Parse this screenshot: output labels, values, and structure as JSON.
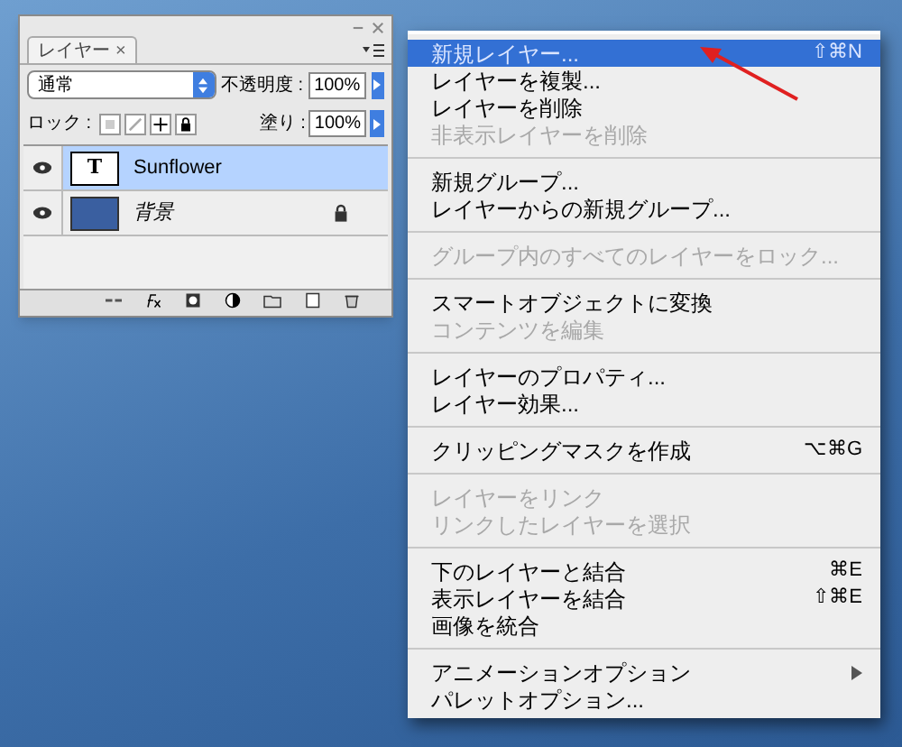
{
  "panel": {
    "tab": {
      "label": "レイヤー",
      "close": "×",
      "selected": true
    },
    "blend_mode": "通常",
    "opacity": {
      "label": "不透明度 :",
      "value": "100%"
    },
    "lock": {
      "label": "ロック :"
    },
    "fill": {
      "label": "塗り :",
      "value": "100%"
    },
    "layers": [
      {
        "name": "Sunflower",
        "kind": "text",
        "thumb_text": "T",
        "visible": true,
        "selected": true,
        "locked": false
      },
      {
        "name": "背景",
        "kind": "background",
        "visible": true,
        "selected": false,
        "locked": true
      }
    ]
  },
  "menu": {
    "groups": [
      [
        {
          "label": "新規レイヤー...",
          "shortcut": "⇧⌘N",
          "disabled": false,
          "selected": true
        },
        {
          "label": "レイヤーを複製...",
          "disabled": false,
          "selected": false
        },
        {
          "label": "レイヤーを削除",
          "disabled": false,
          "selected": false
        },
        {
          "label": "非表示レイヤーを削除",
          "disabled": true,
          "selected": false
        }
      ],
      [
        {
          "label": "新規グループ...",
          "disabled": false,
          "selected": false
        },
        {
          "label": "レイヤーからの新規グループ...",
          "disabled": false,
          "selected": false
        }
      ],
      [
        {
          "label": "グループ内のすべてのレイヤーをロック...",
          "disabled": true,
          "selected": false
        }
      ],
      [
        {
          "label": "スマートオブジェクトに変換",
          "disabled": false,
          "selected": false
        },
        {
          "label": "コンテンツを編集",
          "disabled": true,
          "selected": false
        }
      ],
      [
        {
          "label": "レイヤーのプロパティ...",
          "disabled": false,
          "selected": false
        },
        {
          "label": "レイヤー効果...",
          "disabled": false,
          "selected": false
        }
      ],
      [
        {
          "label": "クリッピングマスクを作成",
          "shortcut": "⌥⌘G",
          "disabled": false,
          "selected": false
        }
      ],
      [
        {
          "label": "レイヤーをリンク",
          "disabled": true,
          "selected": false
        },
        {
          "label": "リンクしたレイヤーを選択",
          "disabled": true,
          "selected": false
        }
      ],
      [
        {
          "label": "下のレイヤーと結合",
          "shortcut": "⌘E",
          "disabled": false,
          "selected": false
        },
        {
          "label": "表示レイヤーを結合",
          "shortcut": "⇧⌘E",
          "disabled": false,
          "selected": false
        },
        {
          "label": "画像を統合",
          "disabled": false,
          "selected": false
        }
      ],
      [
        {
          "label": "アニメーションオプション",
          "disabled": false,
          "selected": false,
          "submenu": true
        },
        {
          "label": "パレットオプション...",
          "disabled": false,
          "selected": false
        }
      ]
    ]
  }
}
